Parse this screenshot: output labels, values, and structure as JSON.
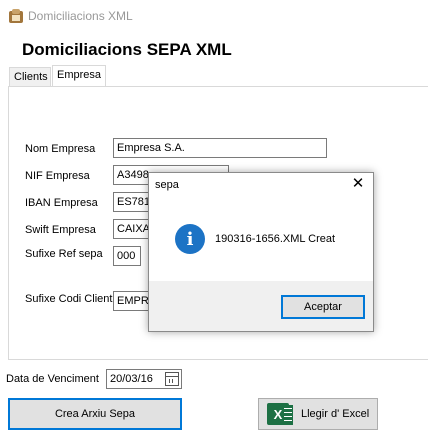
{
  "window": {
    "title": "Domiciliacions XML",
    "icon": "app-icon"
  },
  "header": {
    "title": "Domiciliacions SEPA XML"
  },
  "tabs": [
    {
      "label": "Clients",
      "active": false
    },
    {
      "label": "Empresa",
      "active": true
    }
  ],
  "empresa": {
    "nom_label": "Nom Empresa",
    "nom_value": "Empresa S.A.",
    "nif_label": "NIF Empresa",
    "nif_value": "A3498",
    "iban_label": "IBAN Empresa",
    "iban_value": "ES781",
    "swift_label": "Swift Empresa",
    "swift_value": "CAIXA",
    "sufixe_ref_label": "Sufixe Ref sepa",
    "sufixe_ref_value": "000",
    "sufixe_codi_label": "Sufixe Codi Client",
    "sufixe_codi_value": "EMPR"
  },
  "footer": {
    "date_label": "Data de Venciment",
    "date_value": "20/03/16",
    "crea_button": "Crea Arxiu Sepa",
    "excel_button": "Llegir d' Excel",
    "excel_icon_letter": "X"
  },
  "dialog": {
    "title": "sepa",
    "close_glyph": "✕",
    "icon_glyph": "i",
    "message": "190316-1656.XML Creat",
    "ok_button": "Aceptar"
  },
  "colors": {
    "accent": "#0078d7",
    "info": "#1c73c5",
    "excel": "#1d7044"
  }
}
